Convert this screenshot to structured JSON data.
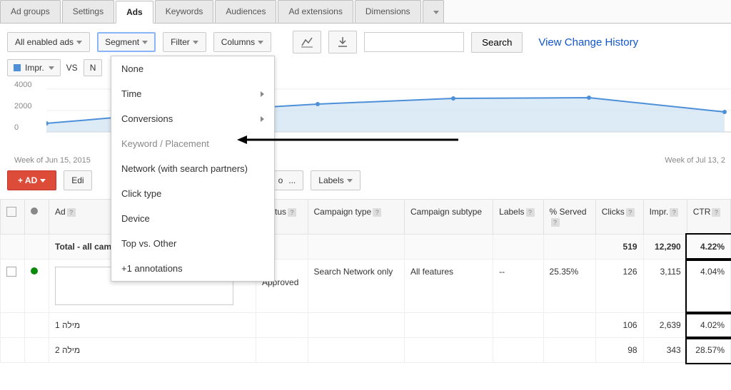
{
  "tabs": [
    "Ad groups",
    "Settings",
    "Ads",
    "Keywords",
    "Audiences",
    "Ad extensions",
    "Dimensions"
  ],
  "active_tab": 2,
  "toolbar": {
    "filter_label": "All enabled ads",
    "segment_label": "Segment",
    "filter_button": "Filter",
    "columns_label": "Columns",
    "search_label": "Search",
    "history_link": "View Change History"
  },
  "metric": {
    "impr_label": "Impr.",
    "vs_label": "VS",
    "none_partial": "N"
  },
  "segment_menu": [
    "None",
    "Time",
    "Conversions",
    "Keyword / Placement",
    "Network (with search partners)",
    "Click type",
    "Device",
    "Top vs. Other",
    "+1 annotations"
  ],
  "segment_submenu_indices": [
    1,
    2
  ],
  "segment_muted_index": 3,
  "chart_data": {
    "type": "line",
    "categories": [
      "Week of Jun 15, 2015",
      "",
      "",
      "",
      "",
      "Week of Jul 13, 2"
    ],
    "values": [
      1000,
      2000,
      2500,
      2900,
      2950,
      2000
    ],
    "ylabel": "",
    "ylim": [
      0,
      4000
    ],
    "yticks": [
      0,
      2000,
      4000
    ]
  },
  "action_bar": {
    "ad_button": "+ AD",
    "edit_label": "Edi",
    "automate_label": "o",
    "labels_label": "Labels",
    "ellipsis": "..."
  },
  "table": {
    "headers": [
      "",
      "",
      "Ad",
      "Status",
      "Campaign type",
      "Campaign subtype",
      "Labels",
      "% Served",
      "Clicks",
      "Impr.",
      "CTR"
    ],
    "help_on": [
      2,
      3,
      4,
      5,
      6,
      7,
      8,
      9,
      10
    ],
    "total_row": {
      "label": "Total - all campaign",
      "clicks": "519",
      "impr": "12,290",
      "ctr": "4.22%"
    },
    "rows": [
      {
        "status": "Approved",
        "campaign_type": "Search Network only",
        "campaign_subtype": "All features",
        "labels": "--",
        "served": "25.35%",
        "clicks": "126",
        "impr": "3,115",
        "ctr": "4.04%"
      },
      {
        "keyword": "מילה 1",
        "clicks": "106",
        "impr": "2,639",
        "ctr": "4.02%"
      },
      {
        "keyword": "מילה 2",
        "clicks": "98",
        "impr": "343",
        "ctr": "28.57%"
      }
    ]
  }
}
